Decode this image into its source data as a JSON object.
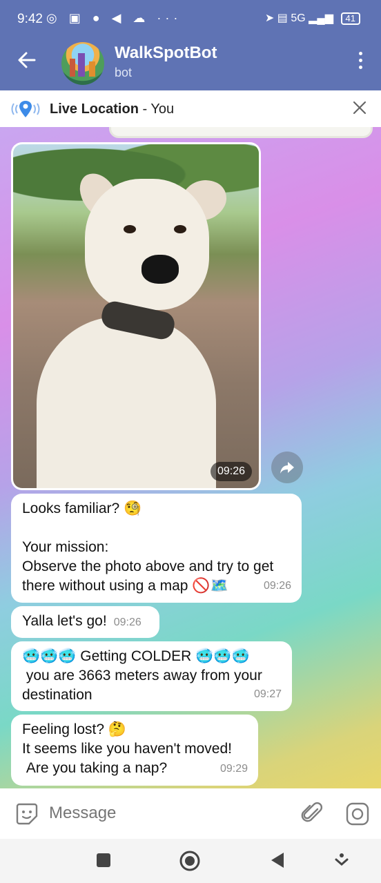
{
  "status_bar": {
    "time": "9:42",
    "left_icons": "◎ ▣ ● ◀ ☁ ···",
    "right_icons": "➤ ▤ 5G ▂▄▆",
    "battery": "41"
  },
  "header": {
    "title": "WalkSpotBot",
    "subtitle": "bot",
    "back_icon": "arrow-left",
    "menu_icon": "more-vertical"
  },
  "live_location": {
    "label": "Live Location",
    "separator": " - ",
    "who": "You"
  },
  "messages": [
    {
      "type": "photo",
      "time": "09:26"
    },
    {
      "type": "text",
      "text": "Looks familiar? 🧐\n\nYour mission:\nObserve the photo above and try to get there without using a map 🚫🗺️",
      "time": "09:26"
    },
    {
      "type": "text",
      "text": "Yalla let's go!",
      "time": "09:26"
    },
    {
      "type": "text",
      "text": "🥶🥶🥶 Getting COLDER 🥶🥶🥶\n you are 3663 meters away from your destination",
      "time": "09:27"
    },
    {
      "type": "text",
      "text": "Feeling lost? 🤔\nIt seems like you haven't moved!\n Are you taking a nap?",
      "time": "09:29"
    }
  ],
  "input": {
    "placeholder": "Message"
  },
  "colors": {
    "header_bg": "#5f73b4",
    "bubble_bg": "#ffffff",
    "live_icon": "#3d8be8"
  }
}
